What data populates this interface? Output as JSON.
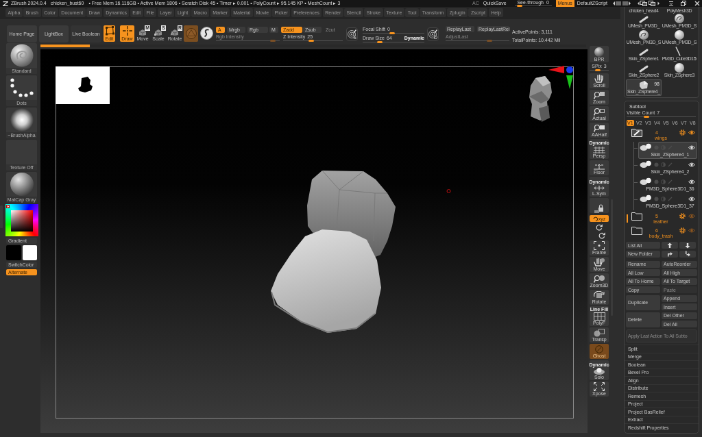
{
  "title_bar": {
    "app": "ZBrush 2024.0.4",
    "document": "chicken_bust60",
    "stats": "• Free Mem 16.116GB • Active Mem 1806 • Scratch Disk 45 • Timer ▸ 0.001 • PolyCount ▸ 95.145 KP • MeshCount ▸ 3",
    "ac": "AC",
    "quicksave": "QuickSave",
    "see_through": {
      "label": "See-through",
      "value": "0",
      "level": 0.08
    },
    "menus": {
      "label": "Menus",
      "on": true
    },
    "zscript": "DefaultZScript"
  },
  "menu": [
    "Alpha",
    "Brush",
    "Color",
    "Document",
    "Draw",
    "Dynamics",
    "Edit",
    "File",
    "Layer",
    "Light",
    "Macro",
    "Marker",
    "Material",
    "Movie",
    "Picker",
    "Preferences",
    "Render",
    "Stencil",
    "Stroke",
    "Texture",
    "Tool",
    "Transform",
    "Zplugin",
    "Zscript",
    "Help"
  ],
  "shelf": {
    "buttons": [
      "Home Page",
      "LightBox",
      "Live Boolean"
    ],
    "modes": [
      {
        "kind": "edit",
        "label": "Edit",
        "on": true
      },
      {
        "kind": "draw",
        "label": "Draw",
        "on": true
      },
      {
        "kind": "move",
        "label": "Move",
        "key": "M",
        "on": false
      },
      {
        "kind": "scale",
        "label": "Scale",
        "key": "S",
        "on": false
      },
      {
        "kind": "rotate",
        "label": "Rotate",
        "key": "R",
        "on": false
      }
    ],
    "channels": [
      {
        "label": "A",
        "on": true,
        "disabled": false
      },
      {
        "label": "Mrgb",
        "on": false,
        "disabled": false
      },
      {
        "label": "Rgb",
        "on": false,
        "disabled": false
      },
      {
        "label": "M",
        "on": false,
        "disabled": false
      },
      {
        "label": "Zadd",
        "on": true,
        "disabled": false
      },
      {
        "label": "Zsub",
        "on": false,
        "disabled": false
      },
      {
        "label": "Zcut",
        "on": false,
        "disabled": true
      }
    ],
    "intensity": [
      {
        "label": "Rgb Intensity",
        "level": 0.93,
        "disabled": true
      },
      {
        "label": "Z Intensity",
        "value": "25",
        "level": 0.47,
        "disabled": false
      }
    ],
    "focal_dial": {
      "letter": "S"
    },
    "brush_sliders": [
      {
        "label": "Focal Shift",
        "value": "0",
        "level": 0.48
      },
      {
        "label": "Draw Size",
        "value": "64",
        "level": 0.26
      }
    ],
    "dynamic": "Dynamic",
    "replay_dial": {
      "letter": "D"
    },
    "replay_buttons": [
      "ReplayLast",
      "ReplayLastRel"
    ],
    "adjust_last": {
      "label": "AdjustLast",
      "level": 0.7,
      "disabled": true
    },
    "points": [
      "ActivePoints: 3,111",
      "TotalPoints: 10.442 Mil"
    ]
  },
  "progress": {
    "level": 0.09
  },
  "left_shelf": {
    "tiles": [
      {
        "kind": "brush",
        "label": "Standard"
      },
      {
        "kind": "stroke",
        "label": "Dots"
      },
      {
        "kind": "alpha",
        "label": "~BrushAlpha"
      },
      {
        "kind": "texture",
        "label": "Texture Off"
      },
      {
        "kind": "material",
        "label": "MatCap Gray"
      }
    ],
    "gradient": "Gradient",
    "swatches": [
      {
        "color": "#000000"
      },
      {
        "color": "#ffffff"
      }
    ],
    "switch_color": "SwitchColor",
    "alternate": {
      "label": "Alternate",
      "on": true
    }
  },
  "view_tools": [
    {
      "kind": "bpr",
      "label": "BPR",
      "on": false,
      "disabled": false
    },
    {
      "kind": "spix",
      "label": "SPix",
      "value": "3",
      "level": 0.4,
      "on": false,
      "disabled": false
    },
    {
      "kind": "scroll",
      "label": "Scroll",
      "on": false,
      "disabled": false
    },
    {
      "kind": "zoom",
      "label": "Zoom",
      "on": false,
      "disabled": false
    },
    {
      "kind": "actual",
      "label": "Actual",
      "on": false,
      "disabled": false
    },
    {
      "kind": "aahalf",
      "label": "AAHalf",
      "on": false,
      "disabled": false
    },
    {
      "kind": "persp",
      "label": "Persp",
      "caption": "Dynamic",
      "on": false,
      "disabled": false
    },
    {
      "kind": "floor",
      "label": "Floor",
      "on": false,
      "disabled": false
    },
    {
      "kind": "lsym",
      "label": "L.Sym",
      "caption": "Dynamic",
      "on": false,
      "disabled": false
    },
    {
      "kind": "lock",
      "on": false,
      "disabled": false
    },
    {
      "kind": "xyz",
      "label": "xyz",
      "on": true,
      "disabled": false
    },
    {
      "kind": "rot-y",
      "on": false,
      "disabled": false
    },
    {
      "kind": "rot-z",
      "on": false,
      "disabled": false
    },
    {
      "kind": "frame",
      "label": "Frame",
      "on": false,
      "disabled": false
    },
    {
      "kind": "move",
      "label": "Move",
      "on": false,
      "disabled": false
    },
    {
      "kind": "zoom3d",
      "label": "Zoom3D",
      "on": false,
      "disabled": false
    },
    {
      "kind": "rotate",
      "label": "Rotate",
      "on": false,
      "disabled": false
    },
    {
      "kind": "polyf",
      "label": "PolyF",
      "caption": "Line Fill",
      "on": false,
      "disabled": false
    },
    {
      "kind": "transp",
      "label": "Transp",
      "on": false,
      "disabled": false
    },
    {
      "kind": "ghost",
      "label": "Ghost",
      "on": true,
      "disabled": true
    },
    {
      "kind": "solo",
      "label": "Solo",
      "caption": "Dynamic",
      "on": false,
      "disabled": false
    },
    {
      "kind": "xpose",
      "label": "Xpose",
      "on": false,
      "disabled": false
    }
  ],
  "tool_palette": {
    "thumbnails": [
      {
        "kind": "none",
        "label": "chicken_head4",
        "selected": false
      },
      {
        "kind": "none",
        "label": "PolyMesh3D",
        "selected": false
      },
      {
        "kind": "stick",
        "label": "UMesh_PM3D_",
        "selected": false
      },
      {
        "kind": "swirl",
        "label": "UMesh_PM3D_S",
        "selected": false
      },
      {
        "kind": "swirl",
        "label": "UMesh_PM3D_S",
        "selected": false
      },
      {
        "kind": "sphere",
        "label": "UMesh_PM3D_S",
        "selected": false
      },
      {
        "kind": "stick",
        "label": "Skin_ZSphere1",
        "selected": false
      },
      {
        "kind": "curve",
        "label": "PM3D_Cube3D1",
        "count": "5",
        "selected": false
      },
      {
        "kind": "stick",
        "label": "Skin_ZSphere2",
        "selected": false
      },
      {
        "kind": "sphere",
        "label": "Skin_ZSphere3",
        "selected": false
      },
      {
        "kind": "blob",
        "label": "Skin_ZSphere4_",
        "count": "98",
        "selected": true
      }
    ]
  },
  "subtool": {
    "title": "Subtool",
    "visible_count": {
      "label": "Visible Count",
      "value": "7",
      "level": 0.27
    },
    "versions": [
      {
        "label": "V1",
        "selected": true
      },
      {
        "label": "V2",
        "selected": false
      },
      {
        "label": "V3",
        "selected": false
      },
      {
        "label": "V4",
        "selected": false
      },
      {
        "label": "V5",
        "selected": false
      },
      {
        "label": "V6",
        "selected": false
      },
      {
        "label": "V7",
        "selected": false
      },
      {
        "label": "V8",
        "selected": false
      }
    ],
    "items": [
      {
        "number": "4",
        "label": "wings",
        "active": true,
        "visible": true,
        "marked": false,
        "children": [
          {
            "label": "Skin_ZSphere4_1",
            "selected": true,
            "visible": true
          },
          {
            "label": "Skin_ZSphere4_2",
            "selected": false,
            "visible": true
          },
          {
            "label": "PM3D_Sphere3D1_36",
            "selected": false,
            "visible": true
          },
          {
            "label": "PM3D_Sphere3D1_37",
            "selected": false,
            "visible": true
          }
        ]
      },
      {
        "number": "5",
        "label": "leather",
        "active": false,
        "visible": false,
        "marked": true
      },
      {
        "number": "6",
        "label": "body_trash",
        "active": false,
        "visible": false,
        "marked": false
      }
    ]
  },
  "subtool_actions": {
    "list": [
      {
        "kind": "text",
        "label": "List All"
      },
      {
        "kind": "up"
      },
      {
        "kind": "down"
      },
      {
        "kind": "text",
        "label": "New Folder"
      },
      {
        "kind": "turn-right"
      },
      {
        "kind": "turn-down"
      }
    ],
    "buttons": [
      {
        "label": "Rename",
        "disabled": false
      },
      {
        "label": "AutoReorder",
        "disabled": false
      },
      {
        "label": "All Low",
        "disabled": false
      },
      {
        "label": "All High",
        "disabled": false
      },
      {
        "label": "All To Home",
        "disabled": false
      },
      {
        "label": "All To Target",
        "disabled": false
      },
      {
        "label": "Copy",
        "disabled": false
      },
      {
        "label": "Paste",
        "disabled": true
      }
    ],
    "groups": [
      {
        "label": "Duplicate",
        "options": [
          "Append",
          "Insert"
        ]
      },
      {
        "label": "Delete",
        "options": [
          "Del Other",
          "Del All"
        ]
      }
    ],
    "apply_all": {
      "label": "Apply Last Action To All Subto",
      "disabled": true
    },
    "sections": [
      "Split",
      "Merge",
      "Boolean",
      "Bevel Pro",
      "Align",
      "Distribute",
      "Remesh",
      "Project",
      "Project BasRelief",
      "Extract",
      "Redshift Properties"
    ]
  }
}
